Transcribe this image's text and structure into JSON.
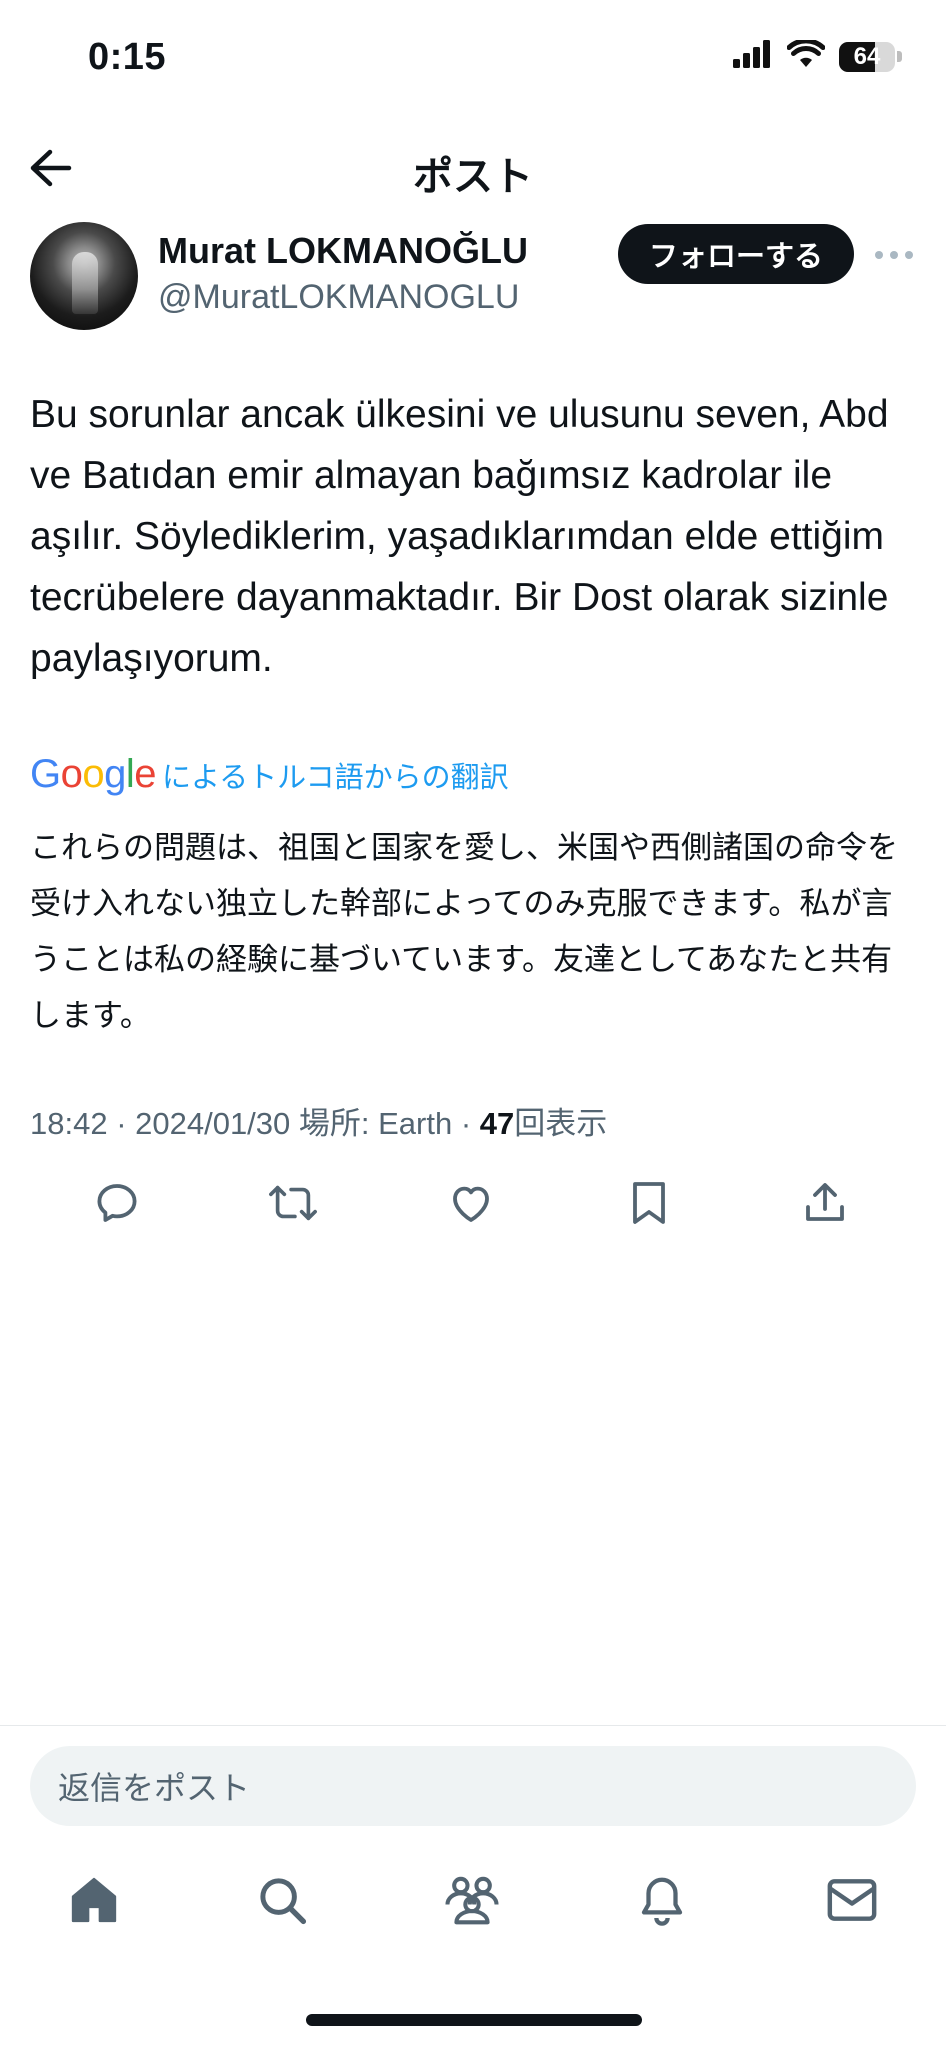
{
  "status_bar": {
    "time": "0:15",
    "battery_level": "64",
    "battery_fraction": 0.64
  },
  "header": {
    "title": "ポスト"
  },
  "author": {
    "name": "Murat LOKMANOĞLU",
    "handle": "@MuratLOKMANOGLU",
    "follow_label": "フォローする"
  },
  "tweet": {
    "text": "Bu sorunlar ancak ülkesini ve ulusunu seven, Abd ve Batıdan emir almayan bağımsız kadrolar ile aşılır. Söylediklerim, yaşadıklarımdan elde ettiğim tecrübelere dayanmaktadır. Bir Dost olarak sizinle paylaşıyorum.",
    "translation_brand": "Google",
    "translation_label": "によるトルコ語からの翻訳",
    "translation": "これらの問題は、祖国と国家を愛し、米国や西側諸国の命令を受け入れない独立した幹部によってのみ克服できます。私が言うことは私の経験に基づいています。友達としてあなたと共有します。",
    "meta_prefix": "18:42 · 2024/01/30 場所: Earth · ",
    "views_count": "47",
    "views_label": "回表示"
  },
  "actions": [
    "reply-icon",
    "repost-icon",
    "like-icon",
    "bookmark-icon",
    "share-icon"
  ],
  "reply": {
    "placeholder": "返信をポスト"
  },
  "nav": [
    "home-icon",
    "search-icon",
    "communities-icon",
    "notifications-icon",
    "messages-icon"
  ],
  "colors": {
    "accent": "#1d9bf0",
    "text": "#0f1419",
    "secondary": "#536471",
    "google_blue": "#4285F4",
    "google_red": "#EA4335",
    "google_yellow": "#FBBC05",
    "google_green": "#34A853"
  }
}
